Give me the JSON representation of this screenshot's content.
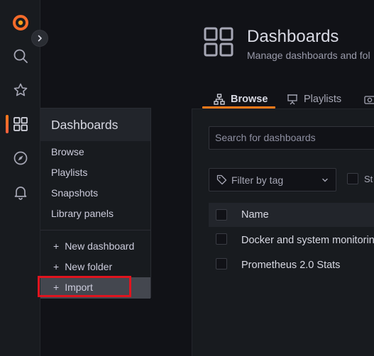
{
  "sidebar": {
    "items": [
      {
        "icon": "grafana-logo-icon"
      },
      {
        "icon": "search-icon"
      },
      {
        "icon": "star-icon"
      },
      {
        "icon": "dashboards-grid-icon"
      },
      {
        "icon": "explore-compass-icon"
      },
      {
        "icon": "alerting-bell-icon"
      }
    ],
    "expand_icon": "chevron-right-icon"
  },
  "header": {
    "title": "Dashboards",
    "subtitle": "Manage dashboards and fol"
  },
  "tabs": [
    {
      "label": "Browse",
      "icon": "sitemap-icon",
      "active": true
    },
    {
      "label": "Playlists",
      "icon": "presentation-icon",
      "active": false
    },
    {
      "label": "",
      "icon": "camera-icon",
      "active": false
    }
  ],
  "browse": {
    "search_placeholder": "Search for dashboards",
    "filter_placeholder": "Filter by tag",
    "starred_label": "St",
    "column_name": "Name",
    "rows": [
      {
        "name": "Docker and system monitorin"
      },
      {
        "name": "Prometheus 2.0 Stats"
      }
    ]
  },
  "flyout": {
    "title": "Dashboards",
    "links": [
      "Browse",
      "Playlists",
      "Snapshots",
      "Library panels"
    ],
    "actions": [
      {
        "label": "New dashboard"
      },
      {
        "label": "New folder"
      },
      {
        "label": "Import",
        "highlighted": true
      }
    ]
  },
  "colors": {
    "accent": "#ff7a1a",
    "background": "#111217",
    "panel": "#181b1f",
    "highlight_border": "#e0141e"
  }
}
